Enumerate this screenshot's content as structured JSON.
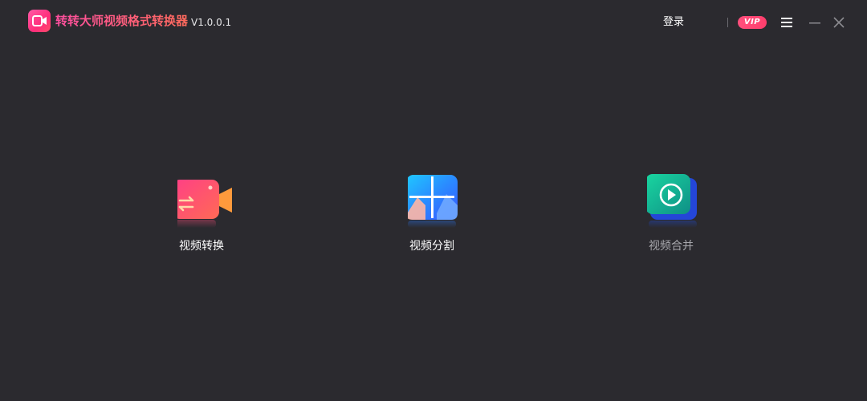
{
  "titlebar": {
    "app_name": "转转大师视频格式转换器",
    "version": "V1.0.0.1",
    "login_label": "登录",
    "vip_label": "VIP",
    "menu_icon": "hamburger-menu-icon",
    "minimize_icon": "minimize-icon",
    "close_icon": "close-icon"
  },
  "features": [
    {
      "label": "视频转换",
      "icon": "video-convert-icon",
      "color": "#ffffff"
    },
    {
      "label": "视频分割",
      "icon": "video-split-icon",
      "color": "#ffffff"
    },
    {
      "label": "视频合并",
      "icon": "video-merge-icon",
      "color": "#a8a8ad"
    }
  ],
  "colors": {
    "background": "#2b2a2f",
    "accent_pink": "#ff3e6c",
    "title_gradient_start": "#ff4fa0",
    "title_gradient_end": "#ff6a5c"
  }
}
